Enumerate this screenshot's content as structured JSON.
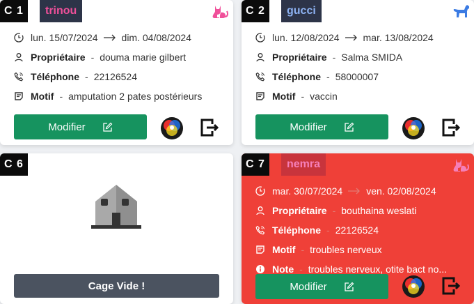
{
  "cards": [
    {
      "cage": "C 1",
      "pet": "trinou",
      "species_icon": "cat-icon",
      "date_from": "lun. 15/07/2024",
      "date_to": "dim. 04/08/2024",
      "owner_label": "Propriétaire",
      "owner": "douma marie gilbert",
      "phone_label": "Téléphone",
      "phone": "22126524",
      "motif_label": "Motif",
      "motif": "amputation 2 pates postérieurs",
      "separator": "-",
      "edit_label": "Modifier"
    },
    {
      "cage": "C 2",
      "pet": "gucci",
      "species_icon": "dog-icon",
      "date_from": "lun. 12/08/2024",
      "date_to": "mar. 13/08/2024",
      "owner_label": "Propriétaire",
      "owner": "Salma SMIDA",
      "phone_label": "Téléphone",
      "phone": "58000007",
      "motif_label": "Motif",
      "motif": "vaccin",
      "separator": "-",
      "edit_label": "Modifier"
    },
    {
      "cage": "C 6",
      "empty_label": "Cage Vide !"
    },
    {
      "cage": "C 7",
      "pet": "nemra",
      "species_icon": "cat-icon",
      "date_from": "mar. 30/07/2024",
      "date_to": "ven. 02/08/2024",
      "owner_label": "Propriétaire",
      "owner": "bouthaina weslati",
      "phone_label": "Téléphone",
      "phone": "22126524",
      "motif_label": "Motif",
      "motif": "troubles nerveux",
      "note_label": "Note",
      "note": "troubles nerveux, otite bact no...",
      "separator": "-",
      "edit_label": "Modifier"
    }
  ],
  "colors": {
    "edit_button": "#16935f",
    "alert_card": "#ef4038",
    "empty_button": "#4b5360",
    "cat_icon": "#f0509a",
    "dog_icon": "#3b7be3"
  }
}
